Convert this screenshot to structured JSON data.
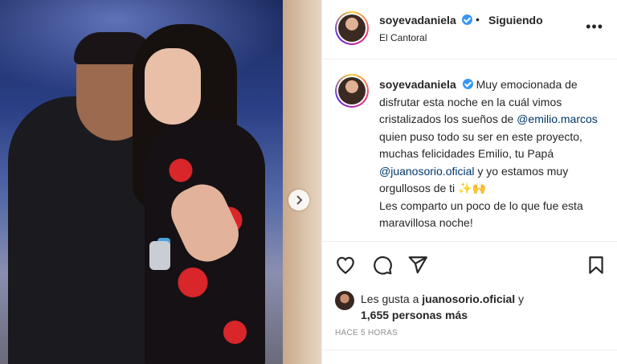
{
  "post": {
    "username": "soyevadaniela",
    "follow_status": "Siguiendo",
    "separator": "•",
    "location": "El Cantoral",
    "more": "•••",
    "caption": {
      "part1": " Muy emocionada de disfrutar esta noche en la cuál vimos cristalizados los sueños de ",
      "mention1": "@emilio.marcos",
      "part2": " quien puso todo su ser en este proyecto, muchas felicidades Emilio, tu Papá ",
      "mention2": "@juanosorio.oficial",
      "part3": " y yo estamos muy orgullosos de ti ✨🙌",
      "part4": "Les comparto un poco de lo que fue esta maravillosa noche!"
    },
    "likes": {
      "prefix": "Les gusta a ",
      "liker": "juanosorio.oficial",
      "connector": " y",
      "others": "1,655 personas más"
    },
    "timestamp": "HACE 5 HORAS"
  },
  "icons": {
    "like": "heart-icon",
    "comment": "comment-icon",
    "share": "send-icon",
    "save": "bookmark-icon",
    "next": "chevron-right-icon"
  },
  "colors": {
    "verified": "#3897f0",
    "mention": "#00376b",
    "muted": "#8e8e8e"
  }
}
